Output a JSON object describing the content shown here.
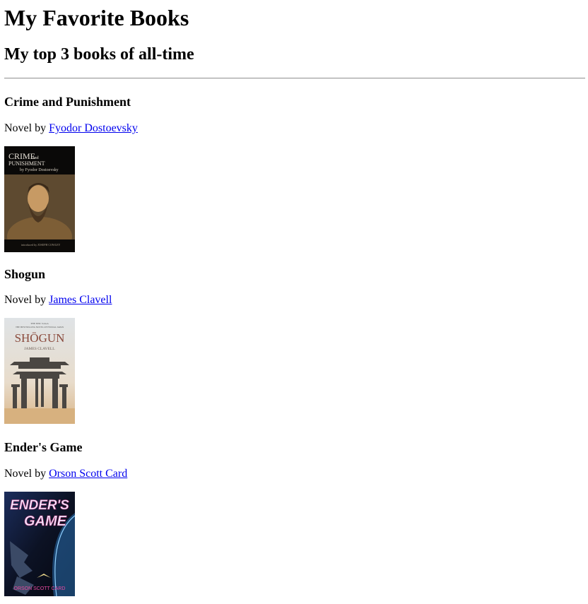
{
  "page": {
    "title": "My Favorite Books",
    "subtitle": "My top 3 books of all-time"
  },
  "books": [
    {
      "title": "Crime and Punishment",
      "prefix": "Novel by ",
      "author": "Fyodor Dostoevsky",
      "cover": {
        "line1": "CRIME",
        "line1b": "and",
        "line2": "PUNISHMENT",
        "line3": "by Fyodor Dostoevsky",
        "footer": "introduced by JOSEPH COWLEY",
        "bg": "#0a0908",
        "accent": "#a8763f"
      }
    },
    {
      "title": "Shogun",
      "prefix": "Novel by ",
      "author": "James Clavell",
      "cover": {
        "tag1": "THE EPIC SAGA",
        "tag2": "THE BESTSELLING NOVEL OF FEUDAL JAPAN",
        "title": "SHŌGUN",
        "author": "JAMES CLAVELL",
        "bg": "#d9dde0",
        "accent": "#8a4a3c"
      }
    },
    {
      "title": "Ender's Game",
      "prefix": "Novel by ",
      "author": "Orson Scott Card",
      "cover": {
        "title1": "ENDER'S",
        "title2": "GAME",
        "author": "ORSON SCOTT CARD",
        "bg": "#0c1224",
        "accent": "#e64aa0"
      }
    }
  ]
}
